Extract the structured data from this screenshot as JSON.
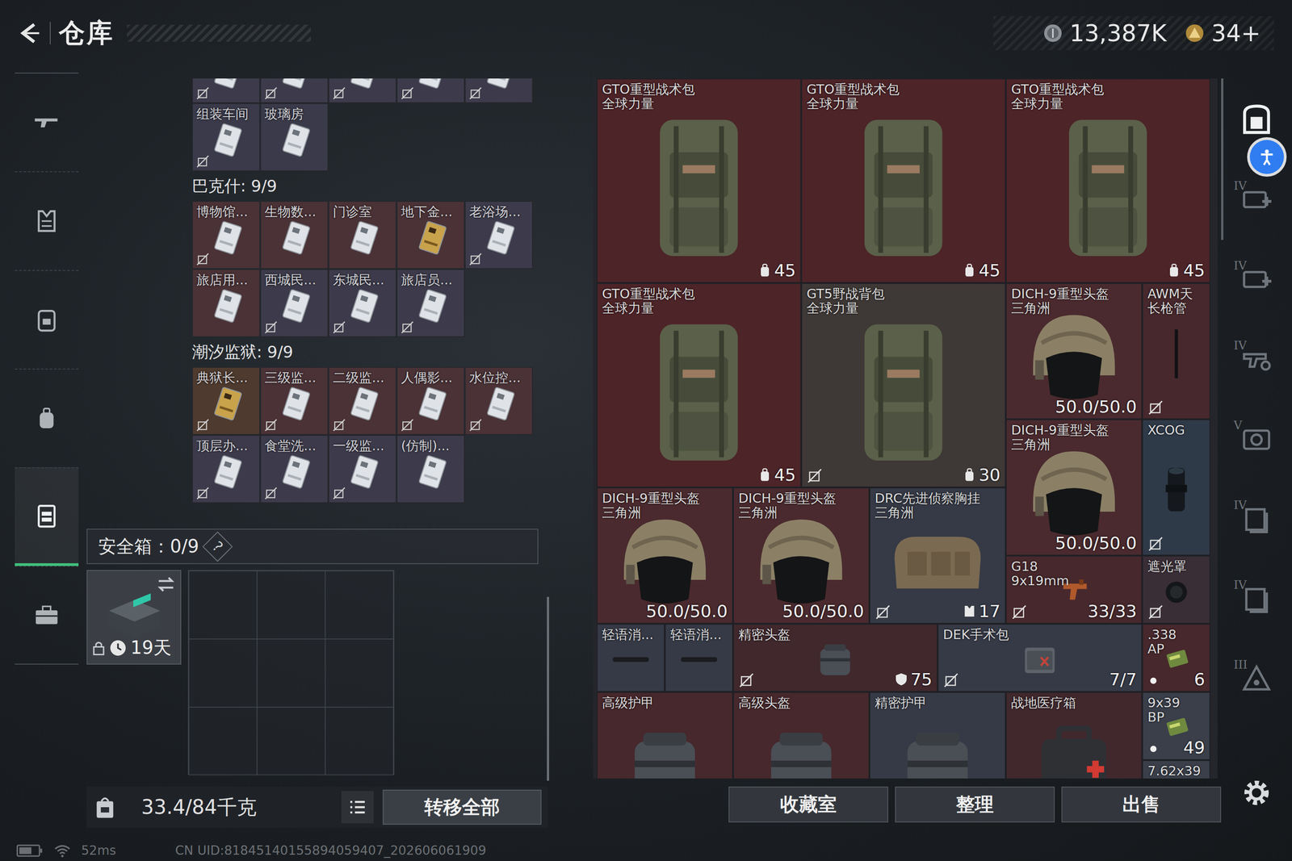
{
  "header": {
    "title": "仓库"
  },
  "currency": [
    {
      "kind": "coin",
      "amount": "13,387K"
    },
    {
      "kind": "gold",
      "amount": "34+"
    }
  ],
  "nav": [
    {
      "kind": "weapon",
      "selected": false
    },
    {
      "kind": "armor",
      "selected": false
    },
    {
      "kind": "backpack",
      "selected": false
    },
    {
      "kind": "bag",
      "selected": false
    },
    {
      "kind": "container",
      "selected": true
    },
    {
      "kind": "toolbox",
      "selected": false
    }
  ],
  "key_sections": [
    {
      "cards": [
        {
          "kind": "white",
          "color": "#3d3b4b",
          "no_trade": true
        },
        {
          "kind": "white",
          "color": "#3d3b4b",
          "no_trade": true
        },
        {
          "kind": "white",
          "color": "#3d3b4b",
          "no_trade": true
        },
        {
          "kind": "white",
          "color": "#3d3b4b",
          "no_trade": true
        },
        {
          "kind": "white",
          "color": "#3d3b4b",
          "no_trade": true
        },
        {
          "label": "组装车间",
          "kind": "white",
          "color": "#3a3a4a",
          "no_trade": true
        },
        {
          "label": "玻璃房",
          "kind": "white",
          "color": "#3a3a4a",
          "no_trade": false
        }
      ]
    },
    {
      "title": "巴克什: 9/9",
      "cards": [
        {
          "label": "博物馆...",
          "kind": "white",
          "color": "#4a3236",
          "no_trade": true
        },
        {
          "label": "生物数...",
          "kind": "white",
          "color": "#4a3236",
          "no_trade": false
        },
        {
          "label": "门诊室",
          "kind": "white",
          "color": "#4a3236",
          "no_trade": false
        },
        {
          "label": "地下金...",
          "kind": "gold",
          "color": "#4a3236",
          "no_trade": false
        },
        {
          "label": "老浴场...",
          "kind": "white",
          "color": "#3d3b4b",
          "no_trade": true
        },
        {
          "label": "旅店用...",
          "kind": "white",
          "color": "#4a3236",
          "no_trade": false
        },
        {
          "label": "西城民...",
          "kind": "white",
          "color": "#3d3b4b",
          "no_trade": true
        },
        {
          "label": "东城民...",
          "kind": "white",
          "color": "#3d3b4b",
          "no_trade": true
        },
        {
          "label": "旅店员...",
          "kind": "white",
          "color": "#3d3b4b",
          "no_trade": true
        }
      ]
    },
    {
      "title": "潮汐监狱: 9/9",
      "cards": [
        {
          "label": "典狱长...",
          "kind": "gold",
          "color": "#4e3a2e",
          "no_trade": true
        },
        {
          "label": "三级监...",
          "kind": "white",
          "color": "#4a3236",
          "no_trade": true
        },
        {
          "label": "二级监...",
          "kind": "white",
          "color": "#4a3236",
          "no_trade": true
        },
        {
          "label": "人偶影...",
          "kind": "white",
          "color": "#4a3236",
          "no_trade": true
        },
        {
          "label": "水位控...",
          "kind": "white",
          "color": "#4a3236",
          "no_trade": true
        },
        {
          "label": "顶层办...",
          "kind": "white",
          "color": "#3d3b4b",
          "no_trade": true
        },
        {
          "label": "食堂洗...",
          "kind": "white",
          "color": "#3d3b4b",
          "no_trade": true
        },
        {
          "label": "一级监...",
          "kind": "white",
          "color": "#3d3b4b",
          "no_trade": true
        },
        {
          "label": "(仿制)...",
          "kind": "white",
          "color": "#3d3b4b",
          "no_trade": false
        }
      ]
    }
  ],
  "safe_box": {
    "title": "安全箱：0/9",
    "help": "?",
    "item": {
      "time": "19天",
      "locked": true
    }
  },
  "weight": "33.4/84千克",
  "transfer_button": "转移全部",
  "stash": [
    {
      "name": [
        "GTO重型战术包",
        "全球力量"
      ],
      "kind": "backpack",
      "color": "#4d2428",
      "badge": "45",
      "badge_icon": "capacity",
      "no_trade": false
    },
    {
      "name": [
        "GTO重型战术包",
        "全球力量"
      ],
      "kind": "backpack",
      "color": "#4d2428",
      "badge": "45",
      "badge_icon": "capacity",
      "no_trade": false
    },
    {
      "name": [
        "GTO重型战术包",
        "全球力量"
      ],
      "kind": "backpack",
      "color": "#4d2428",
      "badge": "45",
      "badge_icon": "capacity",
      "no_trade": false
    },
    {
      "name": [
        "GTO重型战术包",
        "全球力量"
      ],
      "kind": "backpack",
      "color": "#4d2428",
      "badge": "45",
      "badge_icon": "capacity",
      "no_trade": false
    },
    {
      "name": [
        "GT5野战背包",
        "全球力量"
      ],
      "kind": "backpack",
      "color": "#3e3836",
      "badge": "30",
      "badge_icon": "capacity",
      "no_trade": true
    },
    {
      "name": [
        "DICH-9重型头盔",
        "三角洲"
      ],
      "kind": "helmet",
      "color": "#4a2a2e",
      "badge": "50.0/50.0",
      "no_trade": false
    },
    {
      "name": [
        "AWM天",
        "长枪管"
      ],
      "kind": "barrel",
      "color": "#47282c",
      "no_trade": true
    },
    {
      "name": [
        "DICH-9重型头盔",
        "三角洲"
      ],
      "kind": "helmet",
      "color": "#4a2a2e",
      "badge": "50.0/50.0",
      "no_trade": false
    },
    {
      "name": [
        "XCOG"
      ],
      "kind": "scope",
      "color": "#2f3a48",
      "no_trade": true
    },
    {
      "name": [
        "DICH-9重型头盔",
        "三角洲"
      ],
      "kind": "helmet",
      "color": "#4a2a2e",
      "badge": "50.0/50.0",
      "no_trade": false
    },
    {
      "name": [
        "DICH-9重型头盔",
        "三角洲"
      ],
      "kind": "helmet",
      "color": "#4a2a2e",
      "badge": "50.0/50.0",
      "no_trade": false
    },
    {
      "name": [
        "DRC先进侦察胸挂",
        "三角洲"
      ],
      "kind": "rig",
      "color": "#363a46",
      "badge": "17",
      "badge_icon": "vest",
      "no_trade": true
    },
    {
      "name": [
        "G18",
        "9x19mm"
      ],
      "kind": "pistol",
      "color": "#47282c",
      "badge": "33/33",
      "no_trade": true
    },
    {
      "name": [
        "遮光罩"
      ],
      "kind": "shade",
      "color": "#3a2e36",
      "no_trade": true
    },
    {
      "name": [
        "轻语消..."
      ],
      "kind": "suppressor",
      "color": "#363a46",
      "no_trade": false
    },
    {
      "name": [
        "轻语消..."
      ],
      "kind": "suppressor",
      "color": "#363a46",
      "no_trade": false
    },
    {
      "name": [
        "精密头盔"
      ],
      "kind": "case",
      "color": "#40282d",
      "badge": "75",
      "badge_icon": "shield",
      "no_trade": true
    },
    {
      "name": [
        "DEK手术包"
      ],
      "kind": "surgery",
      "color": "#363a46",
      "badge": "7/7",
      "no_trade": true
    },
    {
      "name": [
        ".338",
        "AP"
      ],
      "kind": "ammo",
      "color": "#47282c",
      "badge": "6",
      "no_trade": false
    },
    {
      "name": [
        "高级护甲"
      ],
      "kind": "case",
      "color": "#47282c",
      "no_trade": false
    },
    {
      "name": [
        "高级头盔"
      ],
      "kind": "case",
      "color": "#47282c",
      "no_trade": false
    },
    {
      "name": [
        "精密护甲"
      ],
      "kind": "case",
      "color": "#363a46",
      "no_trade": false
    },
    {
      "name": [
        "战地医疗箱"
      ],
      "kind": "medkit",
      "color": "#40282d",
      "no_trade": false
    },
    {
      "name": [
        "9x39",
        "BP"
      ],
      "kind": "ammo",
      "color": "#3a3f4a",
      "badge": "49",
      "no_trade": false
    },
    {
      "name": [
        "7.62x39"
      ],
      "kind": "ammo",
      "color": "#3a3f4a",
      "no_trade": false
    }
  ],
  "actions": [
    "收藏室",
    "整理",
    "出售"
  ],
  "rail": [
    {
      "kind": "home"
    },
    {
      "kind": "medical",
      "tier": "IV"
    },
    {
      "kind": "medical",
      "tier": "IV"
    },
    {
      "kind": "gear",
      "tier": "IV"
    },
    {
      "kind": "device",
      "tier": "V"
    },
    {
      "kind": "files",
      "tier": "IV"
    },
    {
      "kind": "files",
      "tier": "IV"
    },
    {
      "kind": "triangle",
      "tier": "III"
    }
  ],
  "status": {
    "ping": "52ms",
    "uid": "CN UID:81845140155894059407_202606061909"
  }
}
